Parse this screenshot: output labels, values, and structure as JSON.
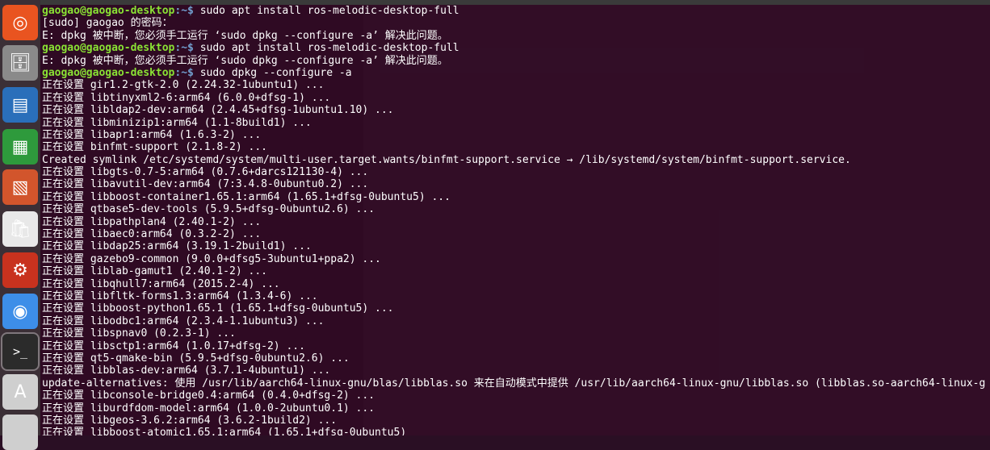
{
  "launcher": {
    "items": [
      {
        "name": "ubuntu-dash-icon",
        "glyph": "◎",
        "color": "#e95420"
      },
      {
        "name": "files-icon",
        "glyph": "🗄",
        "color": "#8a8a8a"
      },
      {
        "name": "writer-icon",
        "glyph": "▤",
        "color": "#2a6fba"
      },
      {
        "name": "calc-icon",
        "glyph": "▦",
        "color": "#2e9a3c"
      },
      {
        "name": "impress-icon",
        "glyph": "▧",
        "color": "#d2552c"
      },
      {
        "name": "software-center-icon",
        "glyph": "🛍",
        "color": "#e8e8e8"
      },
      {
        "name": "settings-icon",
        "glyph": "⚙",
        "color": "#c8321e"
      },
      {
        "name": "chromium-icon",
        "glyph": "◉",
        "color": "#3d8ee8"
      },
      {
        "name": "terminal-icon",
        "glyph": ">_",
        "color": "#2b2b2b"
      },
      {
        "name": "software-updater-icon",
        "glyph": "A",
        "color": "#cfcfcf"
      },
      {
        "name": "more-icon",
        "glyph": "",
        "color": "#cfcfcf"
      }
    ]
  },
  "terminal": {
    "prompt": {
      "user": "gaogao@gaogao-desktop",
      "path": ":~$ "
    },
    "lines": [
      {
        "type": "prompt",
        "text": "sudo apt install ros-melodic-desktop-full"
      },
      {
        "type": "out",
        "text": "[sudo] gaogao 的密码："
      },
      {
        "type": "out",
        "text": "E: dpkg 被中断，您必须手工运行 ‘sudo dpkg --configure -a’ 解决此问题。"
      },
      {
        "type": "prompt",
        "text": "sudo apt install ros-melodic-desktop-full"
      },
      {
        "type": "out",
        "text": "E: dpkg 被中断，您必须手工运行 ‘sudo dpkg --configure -a’ 解决此问题。"
      },
      {
        "type": "prompt",
        "text": "sudo dpkg --configure -a"
      },
      {
        "type": "out",
        "text": "正在设置 gir1.2-gtk-2.0 (2.24.32-1ubuntu1) ..."
      },
      {
        "type": "out",
        "text": "正在设置 libtinyxml2-6:arm64 (6.0.0+dfsg-1) ..."
      },
      {
        "type": "out",
        "text": "正在设置 libldap2-dev:arm64 (2.4.45+dfsg-1ubuntu1.10) ..."
      },
      {
        "type": "out",
        "text": "正在设置 libminizip1:arm64 (1.1-8build1) ..."
      },
      {
        "type": "out",
        "text": "正在设置 libapr1:arm64 (1.6.3-2) ..."
      },
      {
        "type": "out",
        "text": "正在设置 binfmt-support (2.1.8-2) ..."
      },
      {
        "type": "out",
        "text": "Created symlink /etc/systemd/system/multi-user.target.wants/binfmt-support.service → /lib/systemd/system/binfmt-support.service."
      },
      {
        "type": "out",
        "text": "正在设置 libgts-0.7-5:arm64 (0.7.6+darcs121130-4) ..."
      },
      {
        "type": "out",
        "text": "正在设置 libavutil-dev:arm64 (7:3.4.8-0ubuntu0.2) ..."
      },
      {
        "type": "out",
        "text": "正在设置 libboost-container1.65.1:arm64 (1.65.1+dfsg-0ubuntu5) ..."
      },
      {
        "type": "out",
        "text": "正在设置 qtbase5-dev-tools (5.9.5+dfsg-0ubuntu2.6) ..."
      },
      {
        "type": "out",
        "text": "正在设置 libpathplan4 (2.40.1-2) ..."
      },
      {
        "type": "out",
        "text": "正在设置 libaec0:arm64 (0.3.2-2) ..."
      },
      {
        "type": "out",
        "text": "正在设置 libdap25:arm64 (3.19.1-2build1) ..."
      },
      {
        "type": "out",
        "text": "正在设置 gazebo9-common (9.0.0+dfsg5-3ubuntu1+ppa2) ..."
      },
      {
        "type": "out",
        "text": "正在设置 liblab-gamut1 (2.40.1-2) ..."
      },
      {
        "type": "out",
        "text": "正在设置 libqhull7:arm64 (2015.2-4) ..."
      },
      {
        "type": "out",
        "text": "正在设置 libfltk-forms1.3:arm64 (1.3.4-6) ..."
      },
      {
        "type": "out",
        "text": "正在设置 libboost-python1.65.1 (1.65.1+dfsg-0ubuntu5) ..."
      },
      {
        "type": "out",
        "text": "正在设置 libodbc1:arm64 (2.3.4-1.1ubuntu3) ..."
      },
      {
        "type": "out",
        "text": "正在设置 libspnav0 (0.2.3-1) ..."
      },
      {
        "type": "out",
        "text": "正在设置 libsctp1:arm64 (1.0.17+dfsg-2) ..."
      },
      {
        "type": "out",
        "text": "正在设置 qt5-qmake-bin (5.9.5+dfsg-0ubuntu2.6) ..."
      },
      {
        "type": "out",
        "text": "正在设置 libblas-dev:arm64 (3.7.1-4ubuntu1) ..."
      },
      {
        "type": "out",
        "text": "update-alternatives: 使用 /usr/lib/aarch64-linux-gnu/blas/libblas.so 来在自动模式中提供 /usr/lib/aarch64-linux-gnu/libblas.so (libblas.so-aarch64-linux-g"
      },
      {
        "type": "out",
        "text": "正在设置 libconsole-bridge0.4:arm64 (0.4.0+dfsg-2) ..."
      },
      {
        "type": "out",
        "text": "正在设置 liburdfdom-model:arm64 (1.0.0-2ubuntu0.1) ..."
      },
      {
        "type": "out",
        "text": "正在设置 libgeos-3.6.2:arm64 (3.6.2-1build2) ..."
      },
      {
        "type": "out",
        "text": "正在设置 libboost-atomic1.65.1:arm64 (1.65.1+dfsg-0ubuntu5)"
      }
    ]
  }
}
